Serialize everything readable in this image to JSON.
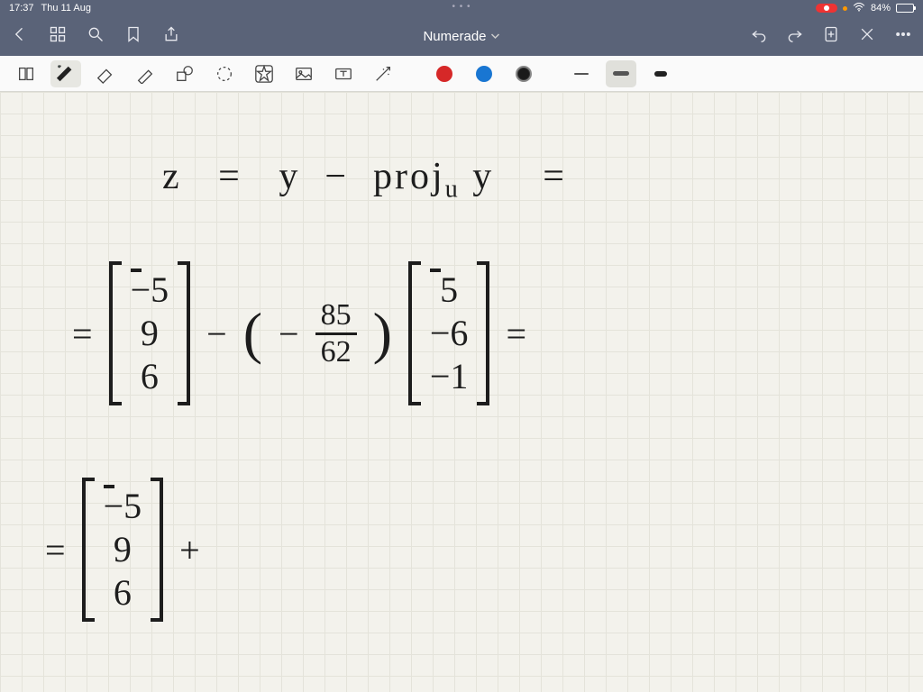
{
  "status": {
    "time": "17:37",
    "date": "Thu 11 Aug",
    "battery_pct": "84%",
    "recording": true
  },
  "nav": {
    "title": "Numerade"
  },
  "toolbar": {
    "tools": [
      "page-tool",
      "pen-tool",
      "eraser-tool",
      "highlighter-tool",
      "shapes-tool",
      "lasso-tool",
      "favorites-tool",
      "image-tool",
      "textbox-tool",
      "laser-tool"
    ],
    "colors": {
      "red": "#d62828",
      "blue": "#1976d2",
      "black": "#1a1a1a"
    },
    "stroke_widths": [
      "thin",
      "medium",
      "thick"
    ],
    "active_stroke": "medium"
  },
  "handwriting": {
    "line1": {
      "lhs": "z",
      "eq": "=",
      "y": "y",
      "minus": "−",
      "proj": "proj",
      "sub": "u",
      "y2": "y",
      "eq2": "="
    },
    "line2": {
      "eq": "=",
      "vec1": [
        "−5",
        "9",
        "6"
      ],
      "minus": "−",
      "scalar_num": "85",
      "scalar_den": "62",
      "scalar_sign": "−",
      "vec2": [
        "5",
        "−6",
        "−1"
      ],
      "eq2": "="
    },
    "line3": {
      "eq": "=",
      "vec": [
        "−5",
        "9",
        "6"
      ],
      "plus": "+"
    }
  }
}
